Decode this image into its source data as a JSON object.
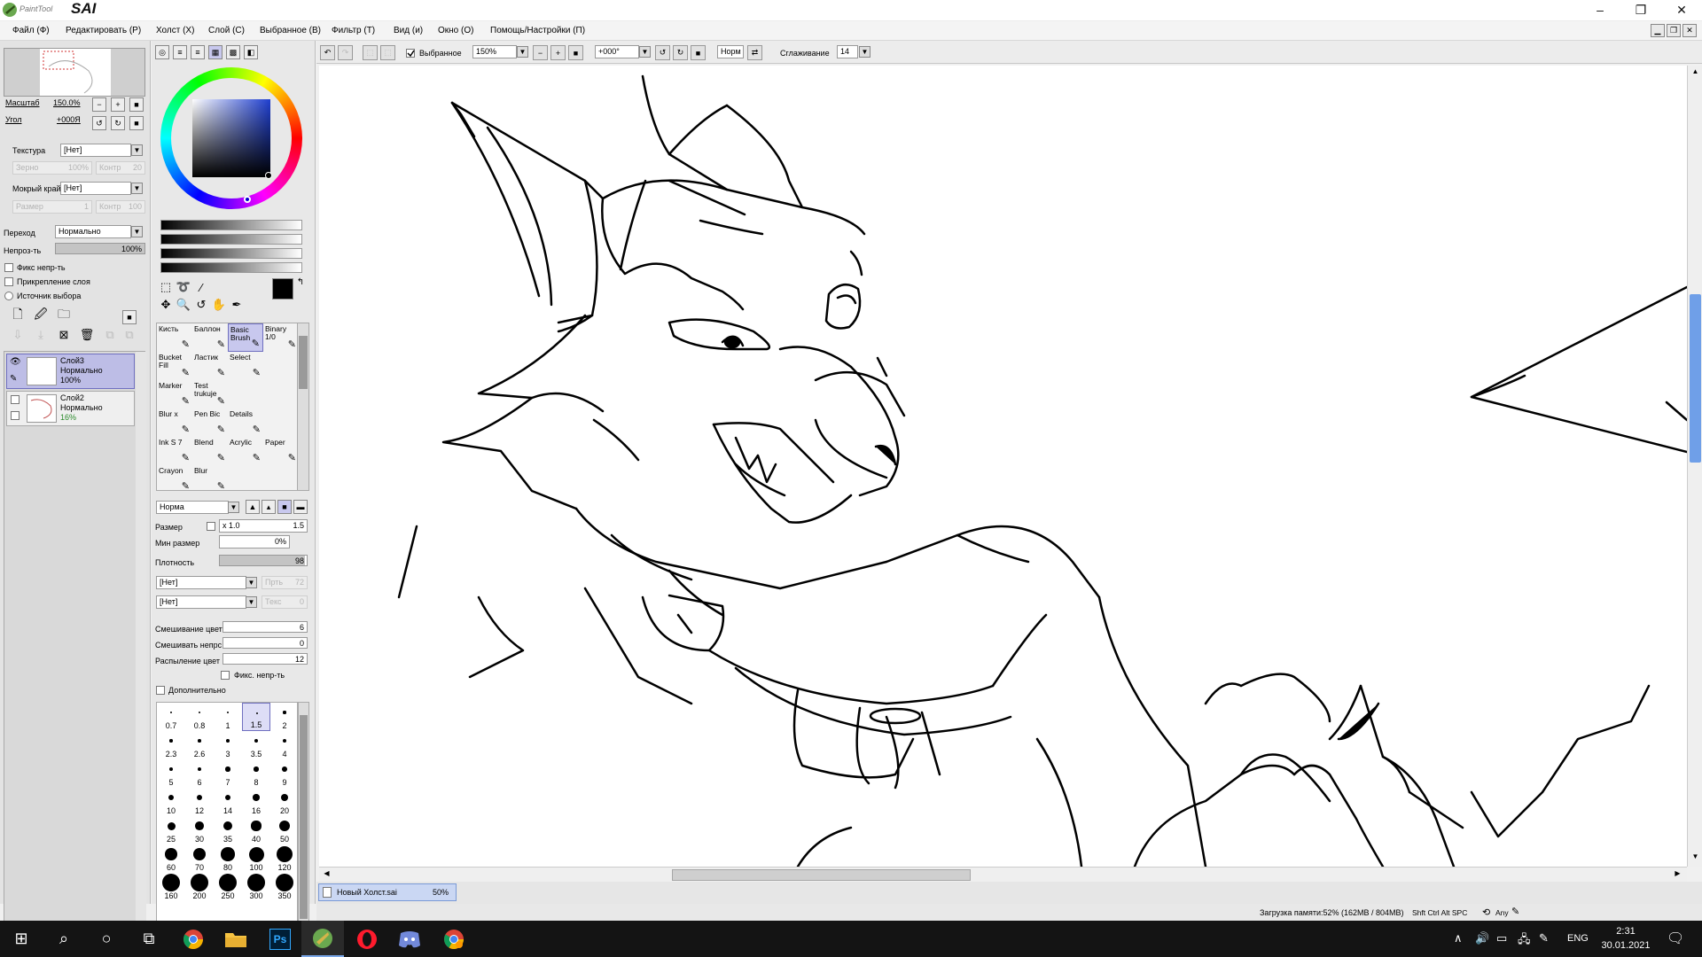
{
  "window": {
    "app_name": "PaintTool",
    "app_name_big": "SAI",
    "minimize": "–",
    "maximize": "❐",
    "close": "✕"
  },
  "menu": [
    "Файл (Ф)",
    "Редактировать (Р)",
    "Холст (Х)",
    "Слой (С)",
    "Выбранное (В)",
    "Фильтр (Т)",
    "Вид (и)",
    "Окно (О)",
    "Помощь/Настройки (П)"
  ],
  "navigator": {
    "scale_label": "Масштаб",
    "scale_value": "150.0%",
    "angle_label": "Угол",
    "angle_value": "+000Я"
  },
  "texture": {
    "label": "Текстура",
    "value": "[Нет]",
    "grain_label": "Зерно",
    "grain_value": "100%",
    "contrast_label": "Контр",
    "contrast_value": "20"
  },
  "wet_edge": {
    "label": "Мокрый край",
    "value": "[Нет]",
    "size_label": "Размер",
    "size_value": "1",
    "contrast_label": "Контр",
    "contrast_value": "100"
  },
  "blend": {
    "label": "Переход",
    "value": "Нормально"
  },
  "opacity": {
    "label": "Непроз-ть",
    "value": "100%",
    "fraction": 1.0
  },
  "checks": [
    "Фикс непр-ть",
    "Прикрепление слоя",
    "Источник выбора"
  ],
  "layers": [
    {
      "name": "Слой3",
      "mode": "Нормально",
      "opacity": "100%",
      "selected": true
    },
    {
      "name": "Слой2",
      "mode": "Нормально",
      "opacity": "16%",
      "selected": false
    }
  ],
  "brushes": [
    {
      "name": "Кисть",
      "selected": false
    },
    {
      "name": "Баллон",
      "selected": false
    },
    {
      "name": "Basic Brush",
      "selected": true
    },
    {
      "name": "Binary 1/0",
      "selected": false
    },
    {
      "name": "Bucket Fill",
      "selected": false
    },
    {
      "name": "Ластик",
      "selected": false
    },
    {
      "name": "Select",
      "selected": false
    },
    {
      "name": "",
      "selected": false
    },
    {
      "name": "Marker",
      "selected": false
    },
    {
      "name": "Test trukuje",
      "selected": false
    },
    {
      "name": "",
      "selected": false
    },
    {
      "name": "",
      "selected": false
    },
    {
      "name": "Blur x",
      "selected": false
    },
    {
      "name": "Pen Bic",
      "selected": false
    },
    {
      "name": "Details",
      "selected": false
    },
    {
      "name": "",
      "selected": false
    },
    {
      "name": "Ink S 7",
      "selected": false
    },
    {
      "name": "Blend",
      "selected": false
    },
    {
      "name": "Acrylic",
      "selected": false
    },
    {
      "name": "Paper",
      "selected": false
    },
    {
      "name": "Crayon",
      "selected": false
    },
    {
      "name": "Blur",
      "selected": false
    },
    {
      "name": "",
      "selected": false
    },
    {
      "name": "",
      "selected": false
    }
  ],
  "brush_settings": {
    "mode": "Норма",
    "size_label": "Размер",
    "size_mult": "x 1.0",
    "size_value": "1.5",
    "min_size_label": "Мин размер",
    "min_size_value": "0%",
    "density_label": "Плотность",
    "density_value": "98",
    "density_fraction": 0.98,
    "shape1": "[Нет]",
    "shape2": "[Нет]",
    "shape1_side_label": "Прть",
    "shape1_side_value": "72",
    "shape2_side_label": "Текс",
    "shape2_side_value": "0",
    "color_blend_label": "Смешивание цвет",
    "color_blend_value": "6",
    "opacity_blend_label": "Смешивать непрс",
    "opacity_blend_value": "0",
    "spray_label": "Распыление цвет",
    "spray_value": "12",
    "fix_label": "Фикс. непр-ть",
    "advanced_label": "Дополнительно"
  },
  "sizes": [
    "0.7",
    "0.8",
    "1",
    "1.5",
    "2",
    "2.3",
    "2.6",
    "3",
    "3.5",
    "4",
    "5",
    "6",
    "7",
    "8",
    "9",
    "10",
    "12",
    "14",
    "16",
    "20",
    "25",
    "30",
    "35",
    "40",
    "50",
    "60",
    "70",
    "80",
    "100",
    "120",
    "160",
    "200",
    "250",
    "300",
    "350"
  ],
  "selected_size": "1.5",
  "canvas_toolbar": {
    "selection_label": "Выбранное",
    "zoom": "150%",
    "angle": "+000°",
    "mode": "Норм",
    "smoothing_label": "Сглаживание",
    "smoothing_value": "14"
  },
  "file_tab": {
    "name": "Новый Холст.sai",
    "zoom": "50%"
  },
  "status": {
    "memory": "Загрузка памяти:52% (162MB / 804MB)",
    "keys": "Shft Ctrl Alt SPC",
    "any": "Any"
  },
  "taskbar": {
    "lang": "ENG",
    "time": "2:31",
    "date": "30.01.2021",
    "apps": [
      "chrome-icon",
      "folder-icon",
      "photoshop-icon",
      "sai-icon",
      "opera-icon",
      "discord-icon",
      "chrome-alt-icon"
    ],
    "ps_label": "Ps"
  }
}
